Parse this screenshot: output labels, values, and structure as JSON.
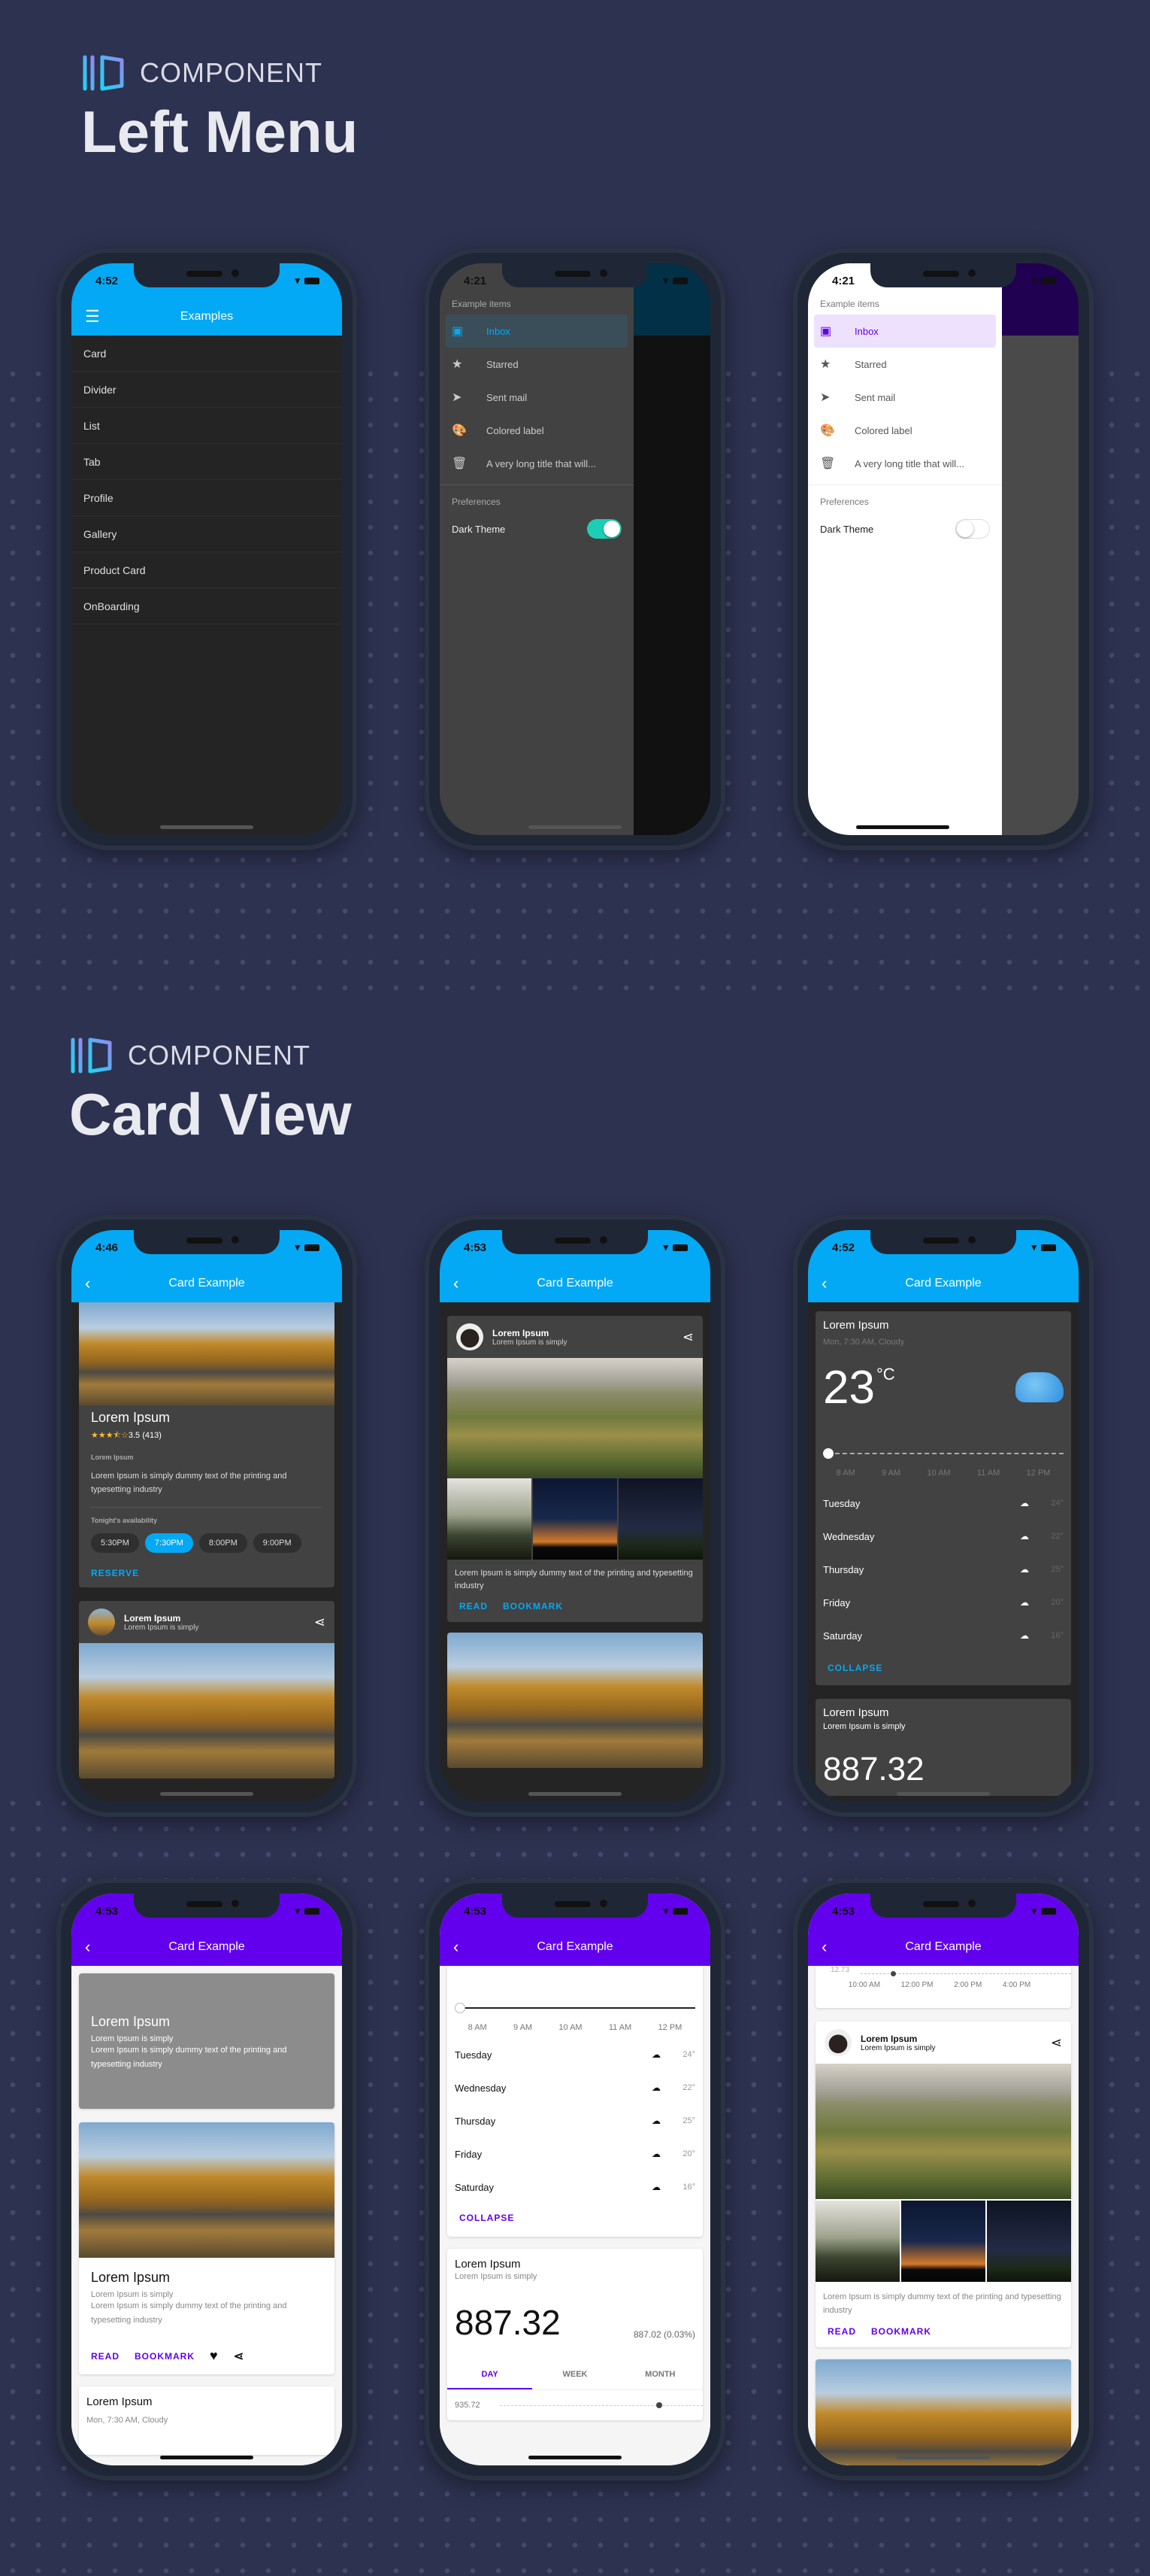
{
  "sections": {
    "left_menu": {
      "kicker": "COMPONENT",
      "title": "Left Menu"
    },
    "card_view": {
      "kicker": "COMPONENT",
      "title": "Card View"
    }
  },
  "colors": {
    "primary_blue": "#03a9f4",
    "primary_purple": "#6200ee",
    "accent_teal": "#1ccfb4",
    "background": "#2d3250"
  },
  "phone1": {
    "time": "4:52",
    "appbar_title": "Examples",
    "nav_icon": "hamburger-menu-icon",
    "menu_items": [
      "Card",
      "Divider",
      "List",
      "Tab",
      "Profile",
      "Gallery",
      "Product Card",
      "OnBoarding"
    ]
  },
  "drawer": {
    "time": "4:21",
    "section_label": "Example items",
    "items": [
      {
        "icon": "inbox-icon",
        "glyph": "▣",
        "label": "Inbox",
        "selected": true
      },
      {
        "icon": "star-icon",
        "glyph": "★",
        "label": "Starred"
      },
      {
        "icon": "send-icon",
        "glyph": "➤",
        "label": "Sent mail"
      },
      {
        "icon": "palette-icon",
        "glyph": "🎨",
        "label": "Colored label"
      },
      {
        "icon": "trash-icon",
        "glyph": "🗑",
        "label": "A very long title that will..."
      }
    ],
    "preferences_label": "Preferences",
    "dark_theme_label": "Dark Theme",
    "dark_variant_toggle_on": true,
    "light_variant_toggle_on": false
  },
  "card_phone_a": {
    "time": "4:46",
    "title": "Card Example",
    "card1": {
      "title": "Lorem Ipsum",
      "stars": "★★★⯪☆",
      "rating": "3.5 (413)",
      "overline": "Lorem Ipsum",
      "body": "Lorem Ipsum is simply dummy text of the printing and typesetting industry",
      "availability_label": "Tonight's availability",
      "times": [
        "5:30PM",
        "7:30PM",
        "8:00PM",
        "9:00PM"
      ],
      "selected_time": "7:30PM",
      "action": "RESERVE"
    },
    "card2": {
      "title": "Lorem Ipsum",
      "subtitle": "Lorem Ipsum is simply"
    }
  },
  "card_phone_b": {
    "time": "4:53",
    "title": "Card Example",
    "card": {
      "title": "Lorem Ipsum",
      "subtitle": "Lorem Ipsum is simply",
      "body": "Lorem Ipsum is simply dummy text of the printing and typesetting industry",
      "actions": [
        "READ",
        "BOOKMARK"
      ]
    }
  },
  "card_phone_c": {
    "time": "4:52",
    "title": "Card Example",
    "weather": {
      "title": "Lorem Ipsum",
      "subtitle": "Mon, 7:30 AM, Cloudy",
      "temp": "23",
      "unit": "°C",
      "hours": [
        "8 AM",
        "9 AM",
        "10 AM",
        "11 AM",
        "12 PM"
      ],
      "forecast": [
        {
          "day": "Tuesday",
          "temp": "24°"
        },
        {
          "day": "Wednesday",
          "temp": "22°"
        },
        {
          "day": "Thursday",
          "temp": "25°"
        },
        {
          "day": "Friday",
          "temp": "20°"
        },
        {
          "day": "Saturday",
          "temp": "16°"
        }
      ],
      "action": "COLLAPSE"
    },
    "stock": {
      "title": "Lorem Ipsum",
      "subtitle": "Lorem Ipsum is simply",
      "value": "887.32"
    }
  },
  "card_phone_d": {
    "time": "4:53",
    "title": "Card Example",
    "overlay_card": {
      "title": "Lorem Ipsum",
      "subtitle": "Lorem Ipsum is simply",
      "body": "Lorem Ipsum is simply dummy text of the printing and typesetting industry"
    },
    "media_card": {
      "title": "Lorem Ipsum",
      "subtitle": "Lorem Ipsum is simply",
      "body": "Lorem Ipsum is simply dummy text of the printing and typesetting industry",
      "actions": [
        "READ",
        "BOOKMARK"
      ]
    },
    "weather_peek": {
      "title": "Lorem Ipsum",
      "subtitle": "Mon, 7:30 AM, Cloudy"
    }
  },
  "card_phone_e": {
    "time": "4:53",
    "title": "Card Example",
    "hours": [
      "8 AM",
      "9 AM",
      "10 AM",
      "11 AM",
      "12 PM"
    ],
    "forecast": [
      {
        "day": "Tuesday",
        "temp": "24°"
      },
      {
        "day": "Wednesday",
        "temp": "22°"
      },
      {
        "day": "Thursday",
        "temp": "25°"
      },
      {
        "day": "Friday",
        "temp": "20°"
      },
      {
        "day": "Saturday",
        "temp": "16°"
      }
    ],
    "action": "COLLAPSE",
    "stock": {
      "title": "Lorem Ipsum",
      "subtitle": "Lorem Ipsum is simply",
      "value": "887.32",
      "change": "887.02 (0.03%)",
      "tabs": [
        "DAY",
        "WEEK",
        "MONTH"
      ],
      "active_tab": "DAY",
      "chart_label": "935.72"
    }
  },
  "card_phone_f": {
    "time": "4:53",
    "title": "Card Example",
    "chart_y_label": "12.73",
    "chart_x_labels": [
      "10:00 AM",
      "12:00 PM",
      "2:00 PM",
      "4:00 PM"
    ],
    "card": {
      "title": "Lorem Ipsum",
      "subtitle": "Lorem Ipsum is simply",
      "body": "Lorem Ipsum is simply dummy text of the printing and typesetting industry",
      "actions": [
        "READ",
        "BOOKMARK"
      ]
    }
  }
}
